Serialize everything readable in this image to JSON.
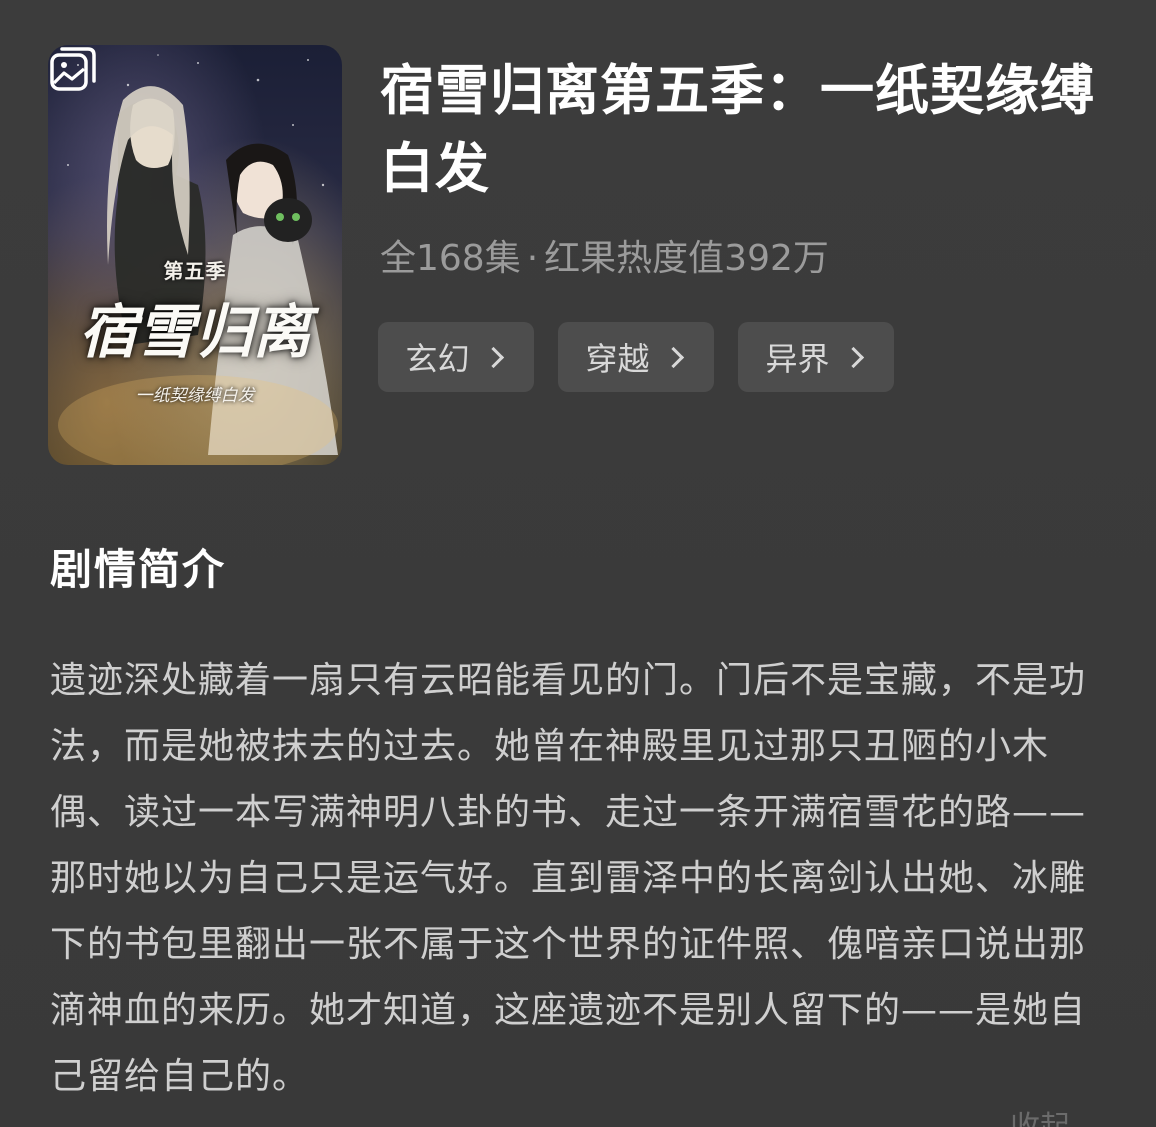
{
  "cover": {
    "season_text": "第五季",
    "title_text": "宿雪归离",
    "subtitle_text": "一纸契缘缚白发",
    "gallery_icon": "gallery-icon"
  },
  "drama": {
    "title": "宿雪归离第五季：一纸契缘缚白发",
    "episodes": "全168集",
    "separator": "·",
    "heat": "红果热度值392万"
  },
  "tags": [
    {
      "label": "玄幻"
    },
    {
      "label": "穿越"
    },
    {
      "label": "异界"
    }
  ],
  "synopsis": {
    "heading": "剧情简介",
    "text": "遗迹深处藏着一扇只有云昭能看见的门。门后不是宝藏，不是功法，而是她被抹去的过去。她曾在神殿里见过那只丑陋的小木偶、读过一本写满神明八卦的书、走过一条开满宿雪花的路——那时她以为自己只是运气好。直到雷泽中的长离剑认出她、冰雕下的书包里翻出一张不属于这个世界的证件照、傀喑亲口说出那滴神血的来历。她才知道，这座遗迹不是别人留下的——是她自己留给自己的。",
    "collapse_label": "收起"
  },
  "colors": {
    "background": "#3a3a3a",
    "title": "#ffffff",
    "meta": "#9b9b9b",
    "tag_bg": "#4d4d4d",
    "body_text": "#cfcfcf"
  }
}
